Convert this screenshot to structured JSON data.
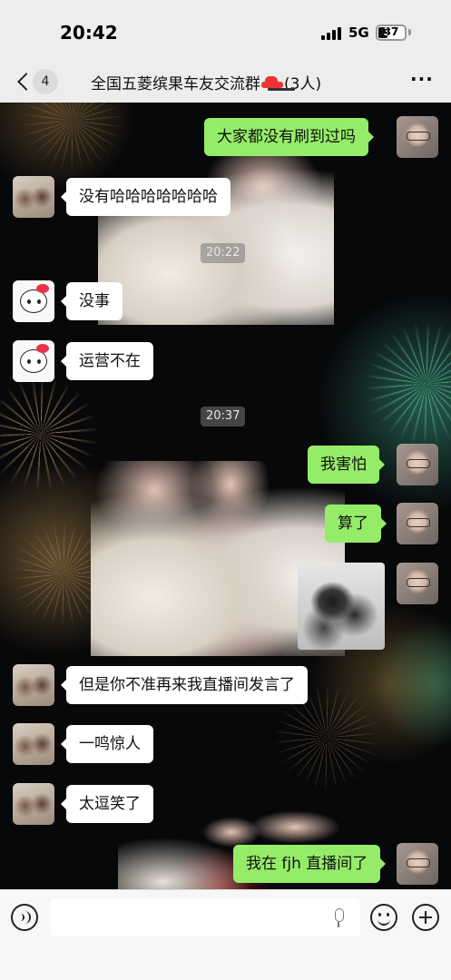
{
  "status_bar": {
    "time": "20:42",
    "network": "5G",
    "battery": "37",
    "battery_level": 0.37
  },
  "header": {
    "unread_count": "4",
    "title_before_emoji": "全国五菱缤果车友交流群",
    "title_emoji": "car-icon",
    "title_after_emoji": "(3人)"
  },
  "messages": [
    {
      "side": "out",
      "sender": "me",
      "text": "大家都没有刷到过吗"
    },
    {
      "side": "in",
      "sender": "couple",
      "text": "没有哈哈哈哈哈哈哈"
    },
    {
      "type": "time",
      "text": "20:22"
    },
    {
      "side": "in",
      "sender": "kitty",
      "text": "没事"
    },
    {
      "side": "in",
      "sender": "kitty",
      "text": "运营不在"
    },
    {
      "type": "time",
      "text": "20:37"
    },
    {
      "side": "out",
      "sender": "me",
      "text": "我害怕"
    },
    {
      "side": "out",
      "sender": "me",
      "text": "算了"
    },
    {
      "side": "out",
      "sender": "me",
      "type": "sticker"
    },
    {
      "side": "in",
      "sender": "couple",
      "text": "但是你不准再来我直播间发言了"
    },
    {
      "side": "in",
      "sender": "couple",
      "text": "一鸣惊人"
    },
    {
      "side": "in",
      "sender": "couple",
      "text": "太逗笑了"
    },
    {
      "side": "out",
      "sender": "me",
      "text": "我在 fjh 直播间了"
    }
  ],
  "input_bar": {
    "placeholder": "",
    "icons": [
      "voice-icon",
      "mic-icon",
      "emoji-icon",
      "plus-icon"
    ]
  },
  "colors": {
    "outgoing_bubble": "#95ec69",
    "incoming_bubble": "#ffffff",
    "header_bg": "#ededed"
  }
}
